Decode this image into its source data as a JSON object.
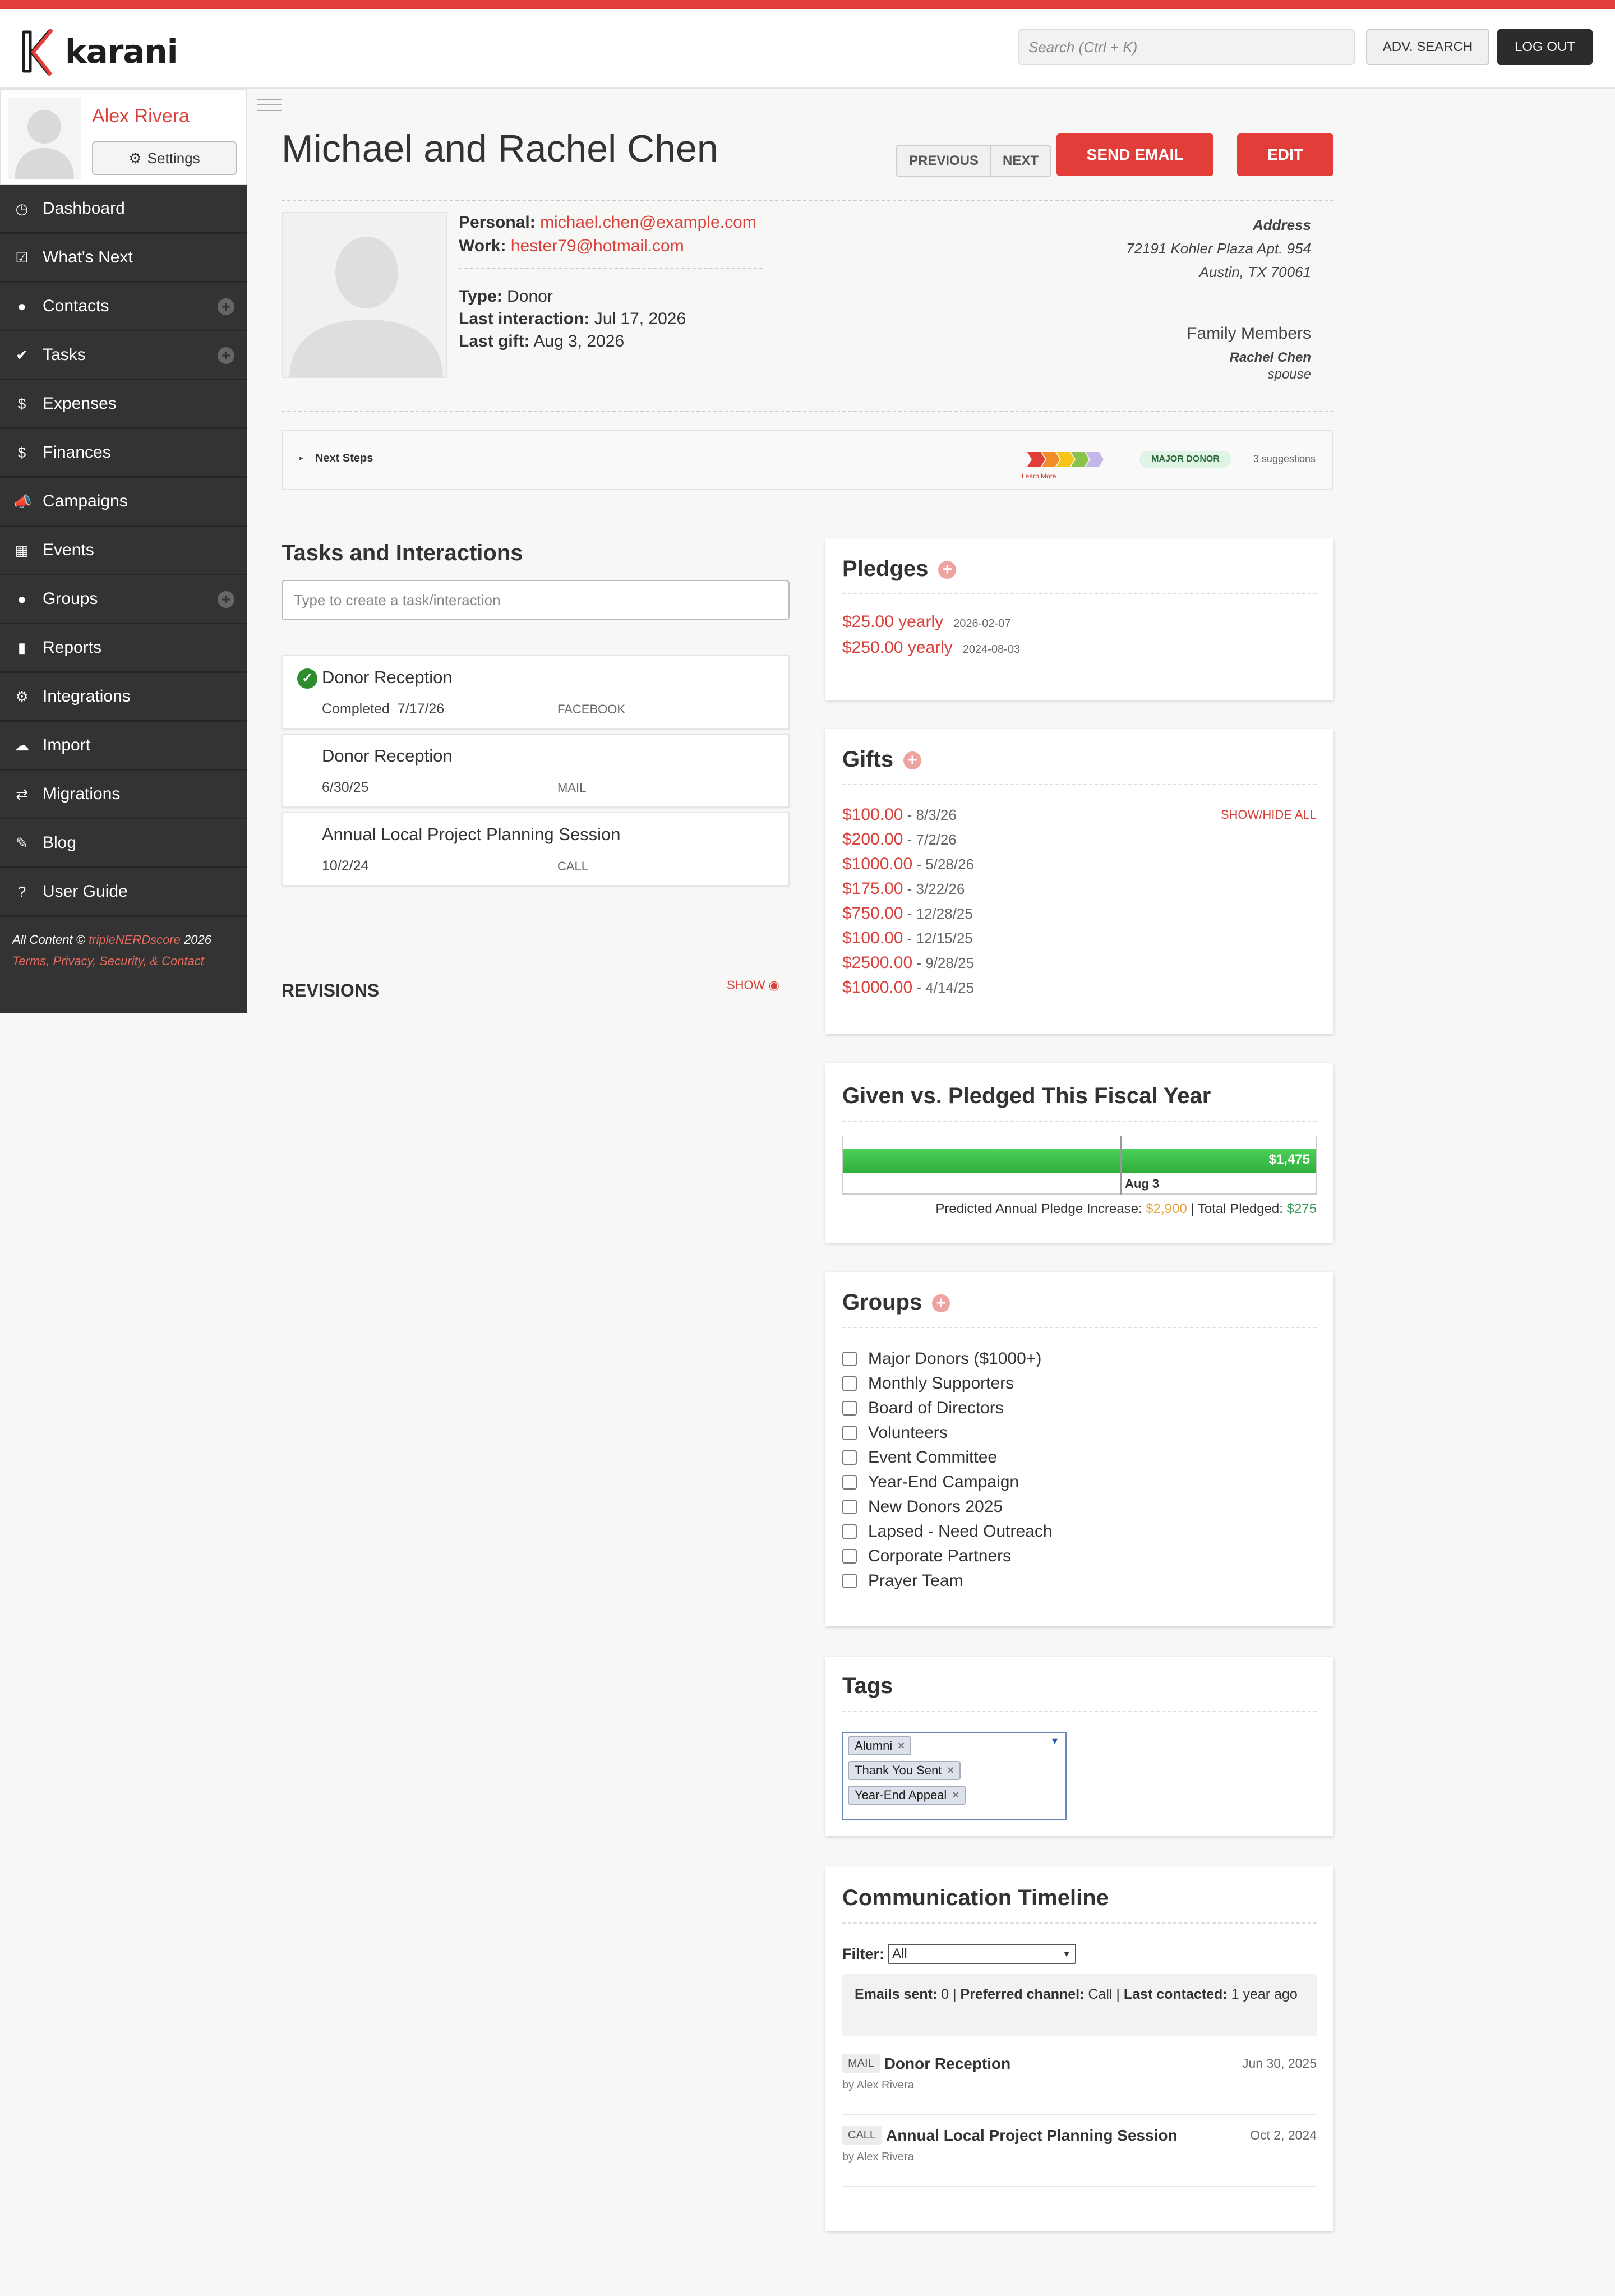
{
  "app": {
    "name": "karani"
  },
  "header": {
    "search_placeholder": "Search (Ctrl + K)",
    "adv_search": "ADV. SEARCH",
    "logout": "LOG OUT"
  },
  "user": {
    "name": "Alex Rivera",
    "settings": "Settings"
  },
  "nav": [
    {
      "label": "Dashboard",
      "icon": "dashboard-icon",
      "glyph": "◷"
    },
    {
      "label": "What's Next",
      "icon": "checklist-icon",
      "glyph": "☑"
    },
    {
      "label": "Contacts",
      "icon": "person-icon",
      "glyph": "●"
    },
    {
      "label": "Tasks",
      "icon": "checkmark-icon",
      "glyph": "✔"
    },
    {
      "label": "Expenses",
      "icon": "dollar-icon",
      "glyph": "$"
    },
    {
      "label": "Finances",
      "icon": "dollar-icon",
      "glyph": "$"
    },
    {
      "label": "Campaigns",
      "icon": "megaphone-icon",
      "glyph": "📣"
    },
    {
      "label": "Events",
      "icon": "calendar-icon",
      "glyph": "▦"
    },
    {
      "label": "Groups",
      "icon": "person-icon",
      "glyph": "●"
    },
    {
      "label": "Reports",
      "icon": "bar-chart-icon",
      "glyph": "▮"
    },
    {
      "label": "Integrations",
      "icon": "gear-icon",
      "glyph": "⚙"
    },
    {
      "label": "Import",
      "icon": "cloud-upload-icon",
      "glyph": "☁"
    },
    {
      "label": "Migrations",
      "icon": "swap-icon",
      "glyph": "⇄"
    },
    {
      "label": "Blog",
      "icon": "pencil-icon",
      "glyph": "✎"
    },
    {
      "label": "User Guide",
      "icon": "question-icon",
      "glyph": "?"
    }
  ],
  "footer": {
    "copyright_prefix": "All Content ©",
    "company": "tripleNERDscore",
    "year": "2026",
    "links": "Terms, Privacy, Security, & Contact"
  },
  "contact": {
    "name": "Michael and Rachel Chen",
    "previous": "PREVIOUS",
    "next": "NEXT",
    "send_email": "SEND EMAIL",
    "edit": "EDIT",
    "personal_label": "Personal:",
    "personal_email": "michael.chen@example.com",
    "work_label": "Work:",
    "work_email": "hester79@hotmail.com",
    "type_label": "Type:",
    "type": "Donor",
    "last_interaction_label": "Last interaction:",
    "last_interaction": "Jul 17, 2026",
    "last_gift_label": "Last gift:",
    "last_gift": "Aug 3, 2026",
    "address_label": "Address",
    "address_line1": "72191 Kohler Plaza Apt. 954",
    "address_line2": "Austin, TX 70061",
    "family_label": "Family Members",
    "family_name": "Rachel Chen",
    "family_relation": "spouse"
  },
  "next_steps": {
    "label": "Next Steps",
    "learn_more": "Learn More",
    "badge": "MAJOR DONOR",
    "suggestions": "3 suggestions"
  },
  "tasks": {
    "title": "Tasks and Interactions",
    "placeholder": "Type to create a task/interaction",
    "items": [
      {
        "title": "Donor Reception",
        "date": "Completed  7/17/26",
        "source": "FACEBOOK",
        "completed": true
      },
      {
        "title": "Donor Reception",
        "date": "6/30/25",
        "source": "MAIL",
        "completed": false
      },
      {
        "title": "Annual Local Project Planning Session",
        "date": "10/2/24",
        "source": "CALL",
        "completed": false
      }
    ],
    "revisions": "REVISIONS",
    "show": "SHOW"
  },
  "pledges": {
    "title": "Pledges",
    "items": [
      {
        "amount": "$25.00 yearly",
        "date": "2026-02-07"
      },
      {
        "amount": "$250.00 yearly",
        "date": "2024-08-03"
      }
    ]
  },
  "gifts": {
    "title": "Gifts",
    "toggle": "SHOW/HIDE ALL",
    "items": [
      {
        "amount": "$100.00",
        "date": " - 8/3/26"
      },
      {
        "amount": "$200.00",
        "date": " - 7/2/26"
      },
      {
        "amount": "$1000.00",
        "date": " - 5/28/26"
      },
      {
        "amount": "$175.00",
        "date": " - 3/22/26"
      },
      {
        "amount": "$750.00",
        "date": " - 12/28/25"
      },
      {
        "amount": "$100.00",
        "date": " - 12/15/25"
      },
      {
        "amount": "$2500.00",
        "date": " - 9/28/25"
      },
      {
        "amount": "$1000.00",
        "date": " - 4/14/25"
      }
    ]
  },
  "given": {
    "title": "Given vs. Pledged This Fiscal Year",
    "value_label": "$1,475",
    "marker_label": "Aug 3",
    "progress": 1.0,
    "predicted_label": "Predicted Annual Pledge Increase:",
    "predicted_value": "$2,900",
    "separator": "|",
    "total_label": "Total Pledged:",
    "total_value": "$275"
  },
  "groups": {
    "title": "Groups",
    "items": [
      "Major Donors ($1000+)",
      "Monthly Supporters",
      "Board of Directors",
      "Volunteers",
      "Event Committee",
      "Year-End Campaign",
      "New Donors 2025",
      "Lapsed - Need Outreach",
      "Corporate Partners",
      "Prayer Team"
    ]
  },
  "tags": {
    "title": "Tags",
    "items": [
      "Alumni",
      "Thank You Sent",
      "Year-End Appeal"
    ]
  },
  "timeline": {
    "title": "Communication Timeline",
    "filter_label": "Filter:",
    "filter_value": "All",
    "emails_label": "Emails sent:",
    "emails_value": "0",
    "channel_label": "Preferred channel:",
    "channel_value": "Call",
    "contacted_label": "Last contacted:",
    "contacted_value": "1 year ago",
    "items": [
      {
        "type": "MAIL",
        "title": "Donor Reception",
        "date": "Jun 30, 2025",
        "by": "by Alex Rivera"
      },
      {
        "type": "CALL",
        "title": "Annual Local Project Planning Session",
        "date": "Oct 2, 2024",
        "by": "by Alex Rivera"
      }
    ]
  },
  "colors": {
    "brand_red": "#e23d38",
    "link_red": "#d9413a",
    "sidebar": "#333333",
    "progress_green": "#3cb44b",
    "predicted_orange": "#e8a33d",
    "total_green": "#3c9a5a"
  }
}
